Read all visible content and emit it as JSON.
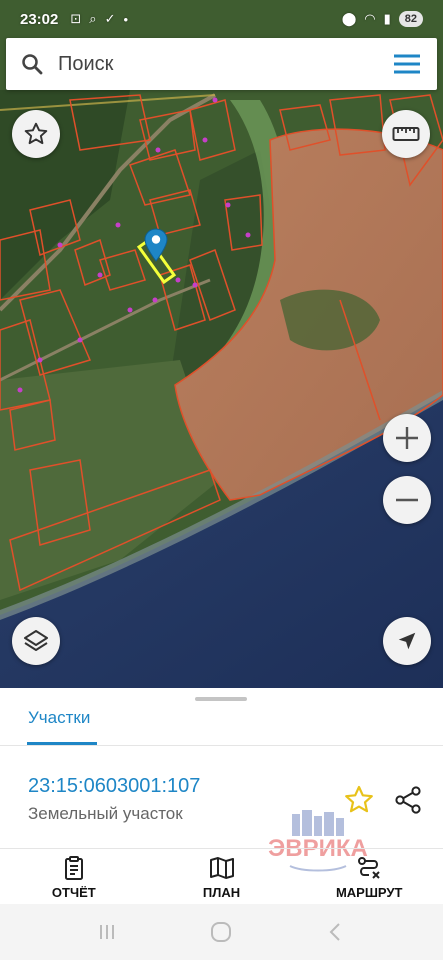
{
  "status_bar": {
    "time": "23:02",
    "battery": "82",
    "left_icons": [
      "screen-record-icon",
      "search-icon",
      "check-icon",
      "dot-icon"
    ],
    "right_icons": [
      "location-icon",
      "wifi-icon",
      "signal-icon",
      "battery-icon"
    ]
  },
  "search": {
    "placeholder": "Поиск"
  },
  "map": {
    "selected_parcel_color": "#f4ff3a",
    "parcel_outline_color": "#e0502a",
    "pin_color": "#1e86c6"
  },
  "map_buttons": {
    "favorites": "star-outline-icon",
    "measure": "ruler-icon",
    "zoom_in": "plus-icon",
    "zoom_out": "minus-icon",
    "layers": "layers-icon",
    "locate": "navigation-arrow-icon"
  },
  "sheet": {
    "tab_label": "Участки",
    "parcel_number": "23:15:0603001:107",
    "parcel_type": "Земельный участок",
    "watermark_text": "ЭВРИКА"
  },
  "actions": [
    {
      "label": "ОТЧЁТ",
      "icon": "report-icon"
    },
    {
      "label": "ПЛАН",
      "icon": "map-icon"
    },
    {
      "label": "МАРШРУТ",
      "icon": "route-icon"
    }
  ],
  "colors": {
    "accent": "#1e86c6",
    "favorite_star": "#e8c21a"
  }
}
